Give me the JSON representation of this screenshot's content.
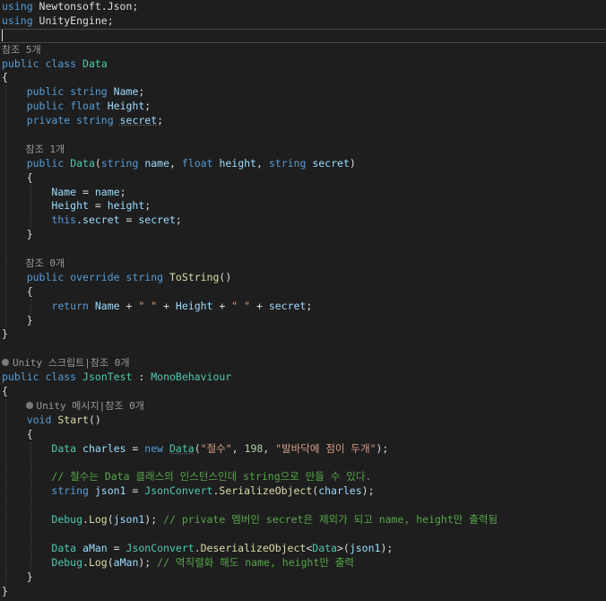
{
  "code": {
    "using1": {
      "kw": "using",
      "ns": " Newtonsoft.Json;"
    },
    "using2": {
      "kw": "using",
      "ns": " UnityEngine;"
    },
    "refs_data_class": "참조 5개",
    "class_data": {
      "kw1": "public",
      "kw2": "class",
      "name": "Data"
    },
    "field_name": {
      "kw1": "public",
      "kw2": "string",
      "name": "Name"
    },
    "field_height": {
      "kw1": "public",
      "kw2": "float",
      "name": "Height"
    },
    "field_secret": {
      "kw1": "private",
      "kw2": "string",
      "name": "secret"
    },
    "refs_ctor": "참조 1개",
    "ctor": {
      "kw": "public",
      "name": "Data",
      "p1t": "string",
      "p1": "name",
      "p2t": "float",
      "p2": "height",
      "p3t": "string",
      "p3": "secret"
    },
    "assign1": {
      "lhs": "Name",
      "rhs": "name"
    },
    "assign2": {
      "lhs": "Height",
      "rhs": "height"
    },
    "assign3": {
      "kw": "this",
      "lhs": ".secret",
      "rhs": "secret"
    },
    "refs_tostring": "참조 0개",
    "tostring_sig": {
      "kw1": "public",
      "kw2": "override",
      "kw3": "string",
      "name": "ToString"
    },
    "return_line": {
      "kw": "return",
      "a": "Name",
      "s1": "\" \"",
      "b": "Height",
      "s2": "\" \"",
      "c": "secret"
    },
    "lens_jsontest": {
      "script": "Unity 스크립트",
      "refs": "참조 0개"
    },
    "class_jsontest": {
      "kw1": "public",
      "kw2": "class",
      "name": "JsonTest",
      "base": "MonoBehaviour"
    },
    "lens_start": {
      "msg": "Unity 메시지",
      "refs": "참조 0개"
    },
    "start_sig": {
      "kw": "void",
      "name": "Start"
    },
    "charles_line": {
      "type": "Data",
      "var": "charles",
      "kw": "new",
      "ctor": "Data",
      "s1": "\"철수\"",
      "num": "198",
      "s2": "\"발바닥에 점이 두개\""
    },
    "comment1": "// 철수는 Data 클래스의 인스턴스인데 string으로 만들 수 있다.",
    "json1_line": {
      "kw": "string",
      "var": "json1",
      "cls": "JsonConvert",
      "method": "SerializeObject",
      "arg": "charles"
    },
    "debug1": {
      "cls": "Debug",
      "method": "Log",
      "arg": "json1",
      "comment": "// private 멤버인 secret은 제외가 되고 name, height만 출력됨"
    },
    "aman_line": {
      "type": "Data",
      "var": "aMan",
      "cls": "JsonConvert",
      "method": "DeserializeObject",
      "generic": "Data",
      "arg": "json1"
    },
    "debug2": {
      "cls": "Debug",
      "method": "Log",
      "arg": "aMan",
      "comment": "// 역직렬화 해도 name, height만 출력"
    }
  }
}
